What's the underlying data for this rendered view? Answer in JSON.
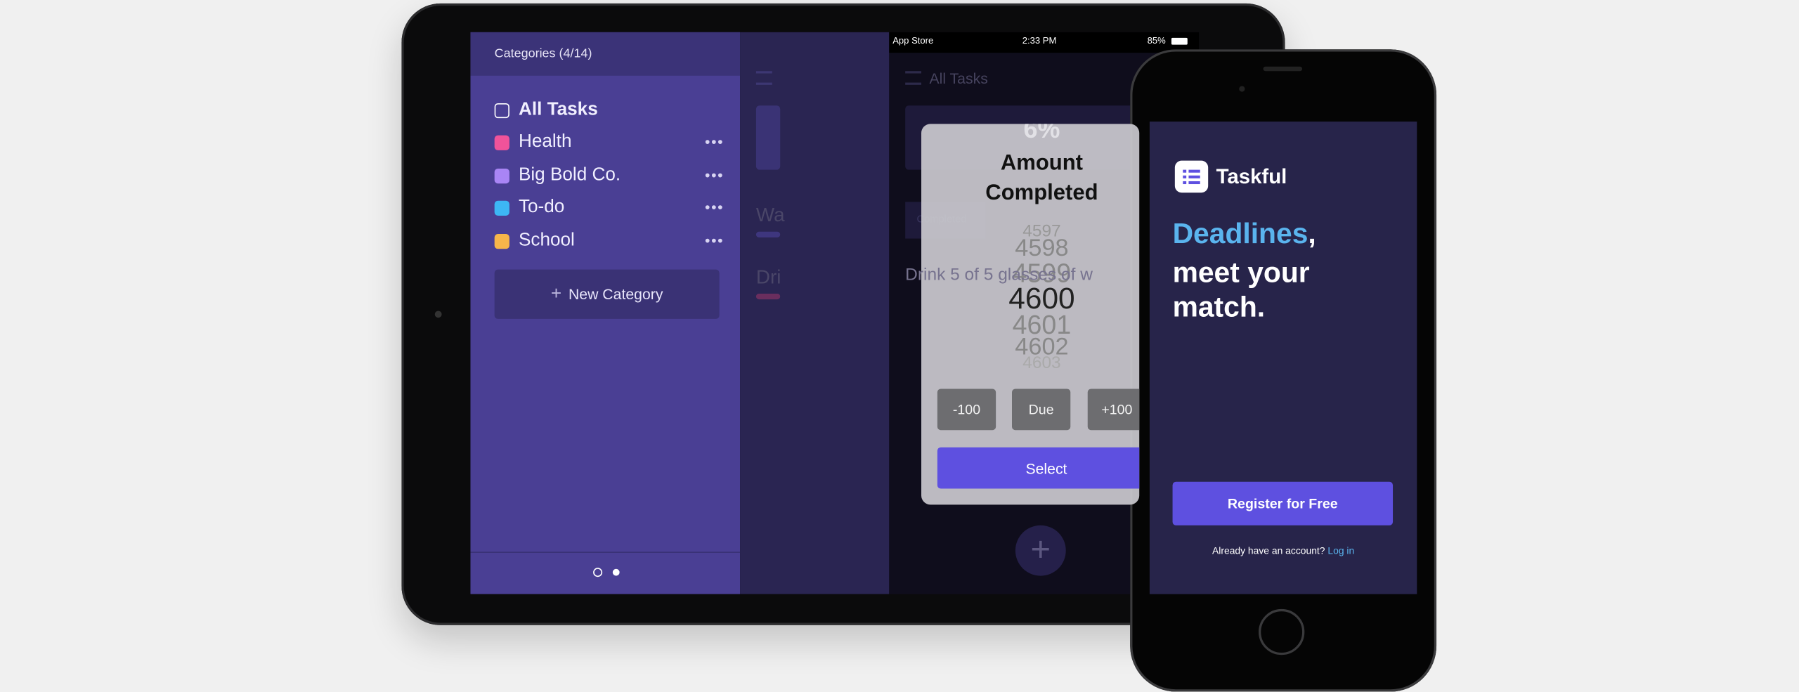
{
  "ipad": {
    "sidebar": {
      "title": "Categories (4/14)",
      "all_tasks": "All Tasks",
      "categories": [
        {
          "label": "Health",
          "color": "#f0539a"
        },
        {
          "label": "Big Bold Co.",
          "color": "#a985f5"
        },
        {
          "label": "To-do",
          "color": "#3db7f5"
        },
        {
          "label": "School",
          "color": "#f7b54a"
        }
      ],
      "more_icon": "•••",
      "new_category": "New Category",
      "plus_icon": "+"
    },
    "middle": {
      "task_1": "Wa",
      "task_2": "Dri"
    },
    "status_bar": {
      "back_app": "App Store",
      "time": "2:33 PM",
      "battery": "85%"
    },
    "app": {
      "header": "All Tasks",
      "percent": "6%",
      "segment": "Completed",
      "task": "Drink 5 of 5 glasses of w",
      "modal": {
        "title_line1": "Amount",
        "title_line2": "Completed",
        "picker": [
          "4597",
          "4598",
          "4599",
          "4600",
          "4601",
          "4602",
          "4603"
        ],
        "selected": "4600",
        "minus": "-100",
        "due": "Due",
        "plus": "+100",
        "select": "Select"
      },
      "fab": "+"
    }
  },
  "phone": {
    "brand": "Taskful",
    "headline_accent": "Deadlines",
    "headline_comma": ",",
    "headline_line2": "meet your",
    "headline_line3": "match.",
    "register": "Register for Free",
    "login_prompt": "Already have an account?",
    "login_link": "Log in",
    "accent_color": "#5ab4ee",
    "button_color": "#5e50e0"
  }
}
